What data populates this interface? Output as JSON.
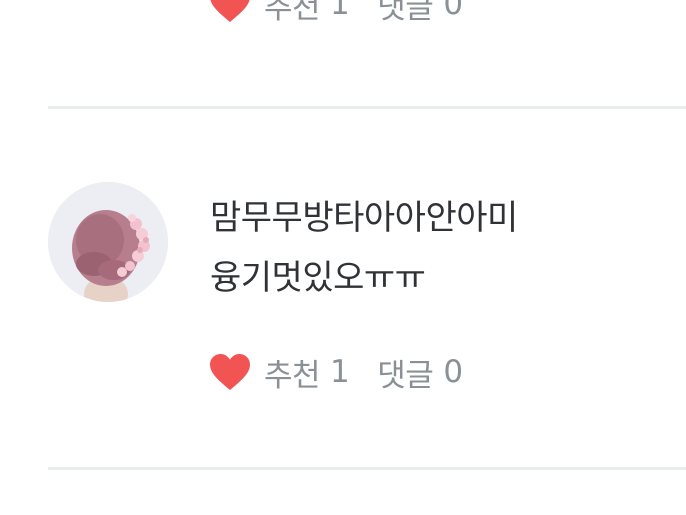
{
  "previous_comment": {
    "like_label": "추천",
    "like_count": "1",
    "reply_label": "댓글",
    "reply_count": "0"
  },
  "comment": {
    "text_line1": "맘무무방타아아안아미",
    "text_line2": "융기멋있오ㅠㅠ",
    "like_label": "추천",
    "like_count": "1",
    "reply_label": "댓글",
    "reply_count": "0"
  },
  "icons": {
    "like": "heart-icon"
  },
  "colors": {
    "heart": "#f25454",
    "muted_text": "#8a9196",
    "body_text": "#2f3337",
    "divider": "#e9eeed",
    "avatar_hair": "#b77f8d",
    "avatar_flowers": "#f3c2cf"
  }
}
